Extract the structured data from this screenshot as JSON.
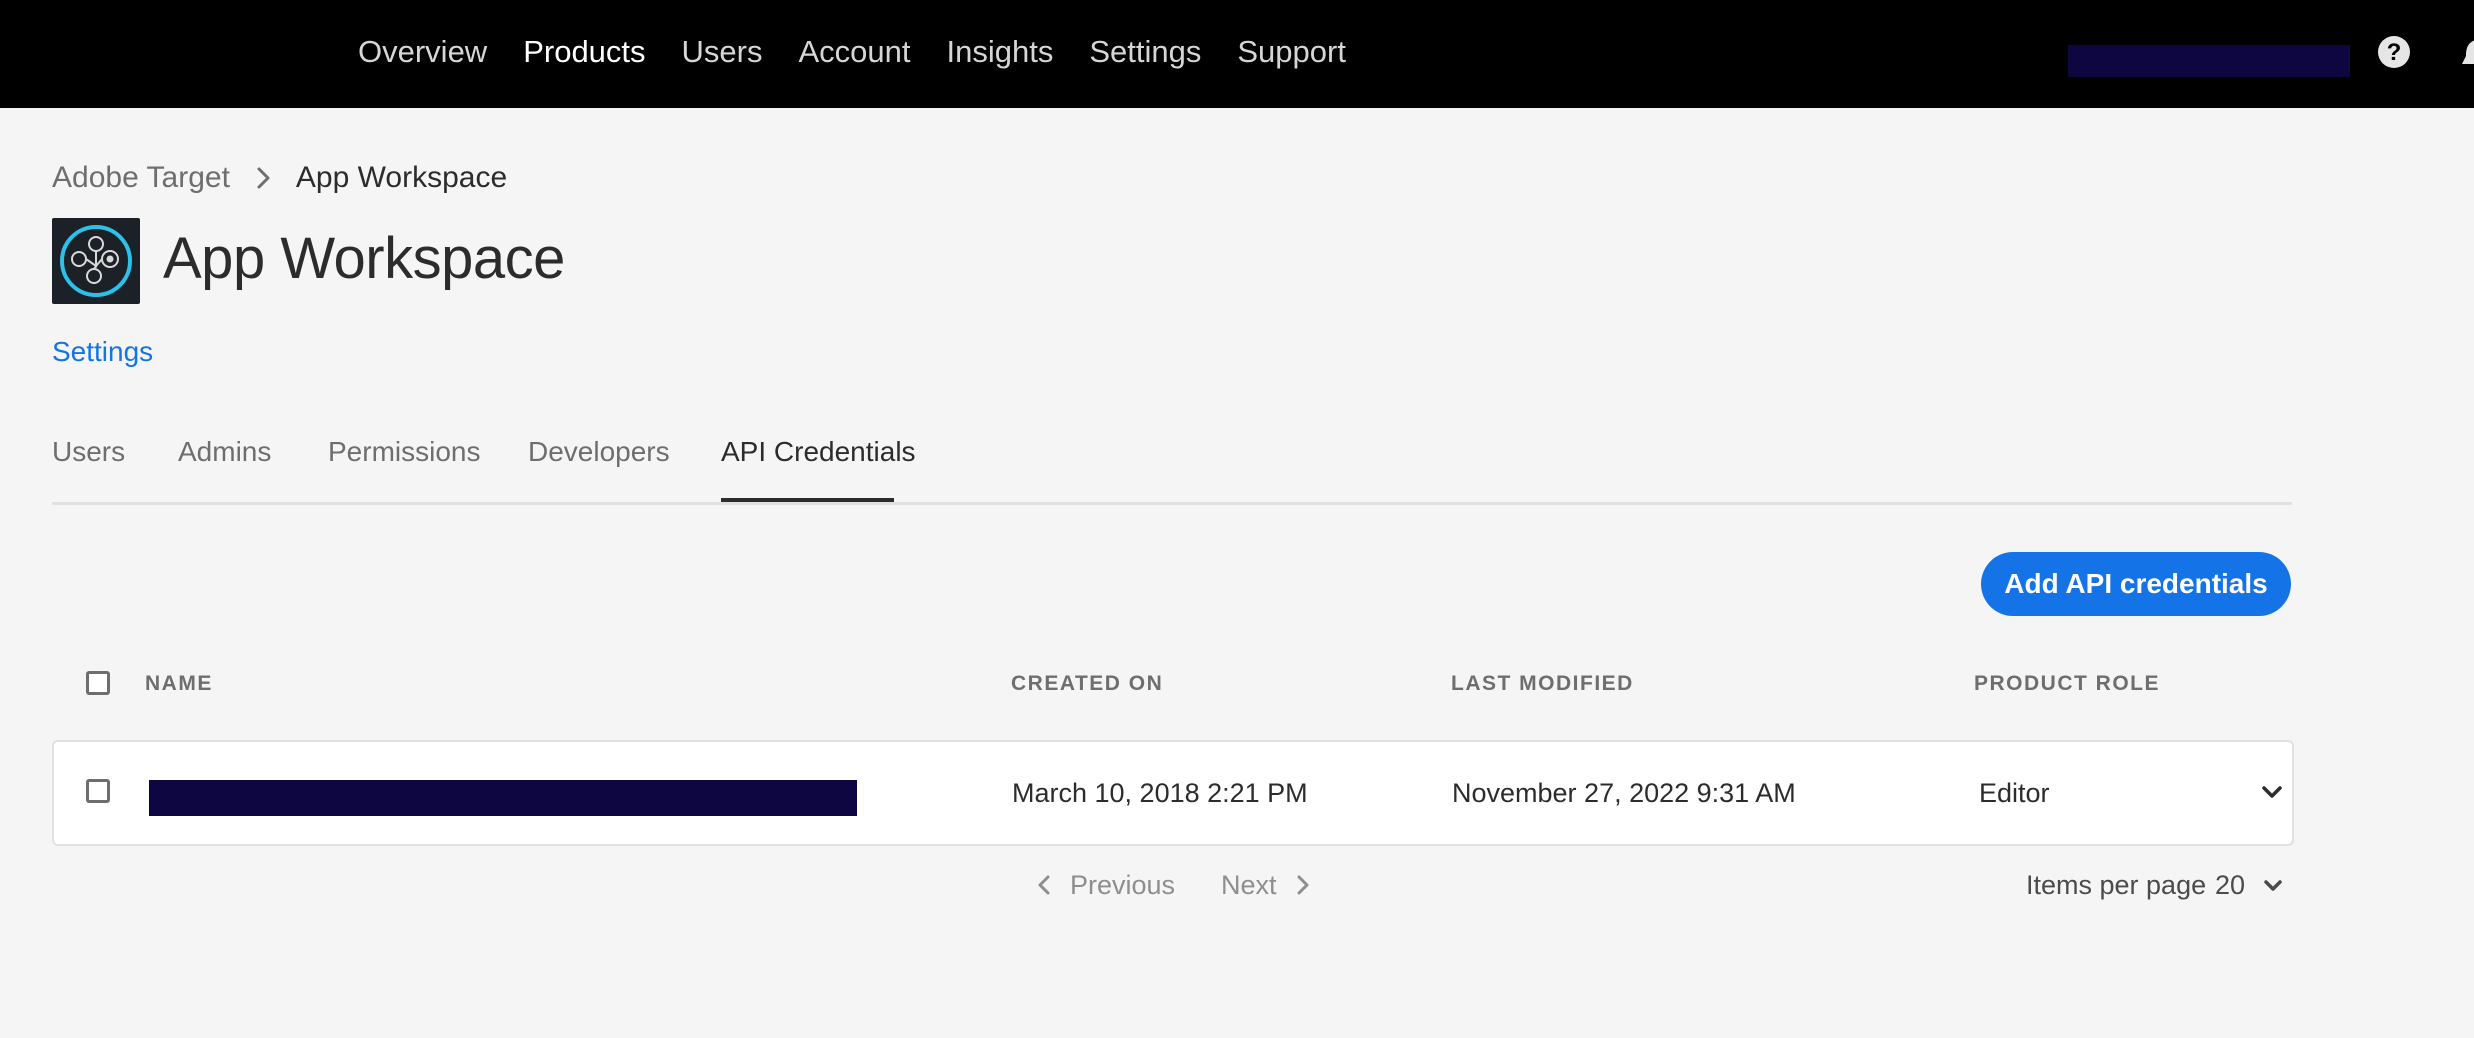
{
  "topnav": {
    "items": [
      "Overview",
      "Products",
      "Users",
      "Account",
      "Insights",
      "Settings",
      "Support"
    ],
    "active": "Products"
  },
  "breadcrumb": {
    "root": "Adobe Target",
    "current": "App Workspace"
  },
  "header": {
    "title": "App Workspace",
    "settings_link": "Settings"
  },
  "tabs": [
    "Users",
    "Admins",
    "Permissions",
    "Developers",
    "API Credentials"
  ],
  "active_tab": "API Credentials",
  "actions": {
    "add_label": "Add API credentials"
  },
  "table": {
    "columns": {
      "name": "NAME",
      "created": "CREATED ON",
      "modified": "LAST MODIFIED",
      "role": "PRODUCT ROLE"
    },
    "rows": [
      {
        "created": "March 10, 2018 2:21 PM",
        "modified": "November 27, 2022 9:31 AM",
        "role": "Editor"
      }
    ]
  },
  "pagination": {
    "previous": "Previous",
    "next": "Next",
    "items_per_page_label": "Items per page",
    "items_per_page": "20"
  },
  "colors": {
    "accent": "#1473e6",
    "topbar": "#000000",
    "redaction": "#0e0640"
  },
  "icons": [
    "help-icon",
    "chevron-right-icon",
    "chevron-down-icon",
    "chevron-left-icon",
    "app-logo-icon"
  ]
}
